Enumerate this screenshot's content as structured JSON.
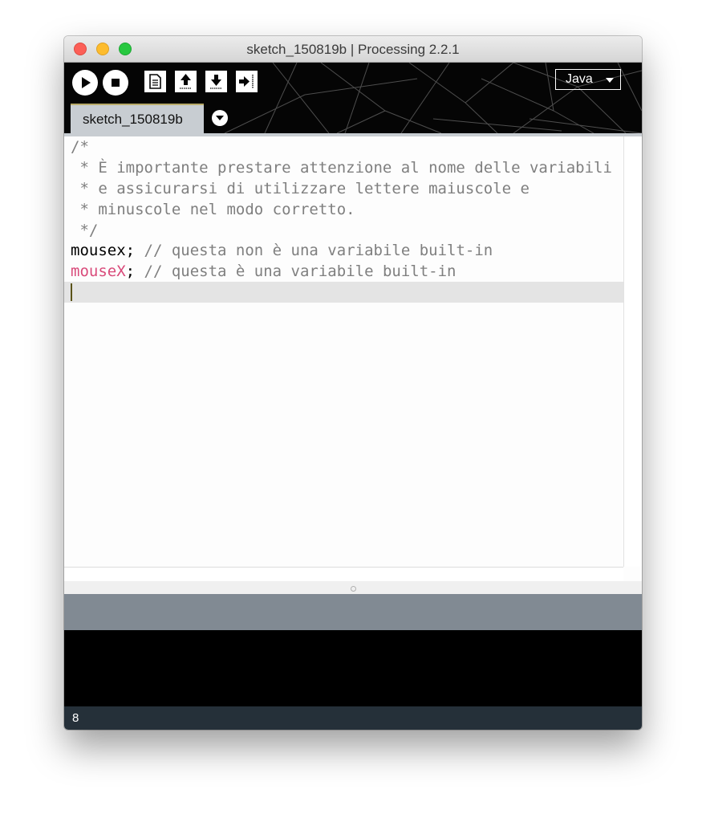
{
  "window": {
    "title": "sketch_150819b | Processing 2.2.1"
  },
  "toolbar": {
    "buttons": [
      "run",
      "stop",
      "new",
      "open",
      "save",
      "export"
    ],
    "mode": "Java"
  },
  "tabs": [
    {
      "label": "sketch_150819b"
    }
  ],
  "editor": {
    "lines": [
      "/*",
      " * È importante prestare attenzione al nome delle variabili",
      " * e assicurarsi di utilizzare lettere maiuscole e",
      " * minuscole nel modo corretto.",
      " */"
    ],
    "line6": {
      "ident": "mousex",
      "semi": ";",
      "comment": " // questa non è una variabile built-in"
    },
    "line7": {
      "ident": "mouseX",
      "semi": ";",
      "comment": " // questa è una variabile built-in"
    }
  },
  "footer": {
    "line_number": "8"
  },
  "colors": {
    "builtin_keyword": "#d94a7a",
    "comment": "#7f7f7f",
    "toolbar_bg": "#050505",
    "status_bar": "#818a93",
    "footer_bg": "#253039"
  },
  "icons": [
    "run-icon",
    "stop-icon",
    "new-sketch-icon",
    "open-icon",
    "save-icon",
    "export-icon",
    "chevron-down-icon"
  ]
}
